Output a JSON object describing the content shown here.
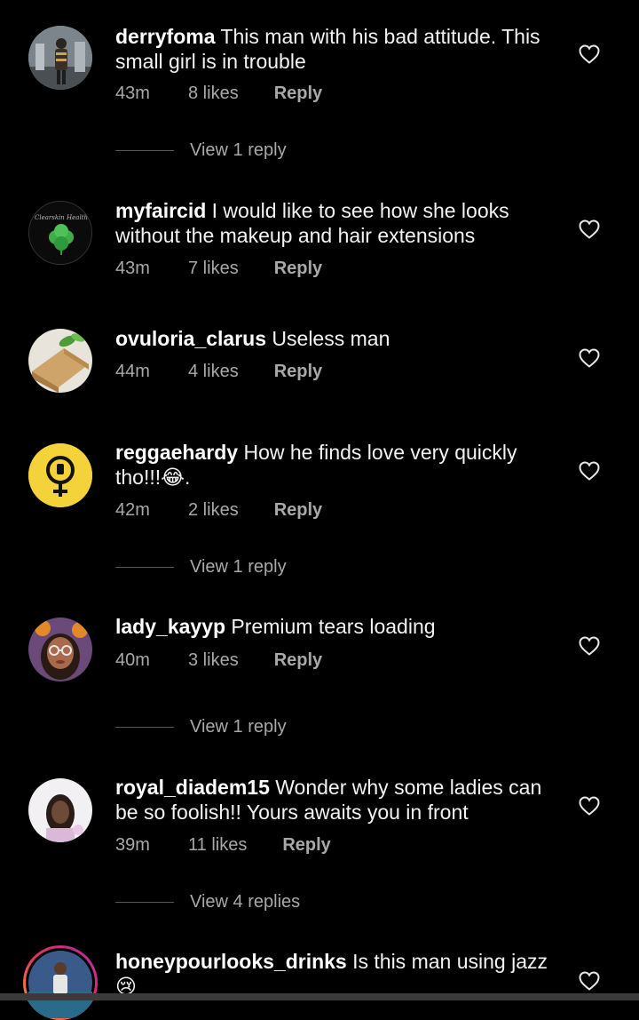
{
  "comments": [
    {
      "username": "derryfoma",
      "text": "This man with his bad attitude. This small girl is in trouble",
      "time": "43m",
      "likes": "8 likes",
      "reply": "Reply",
      "view_replies": "View 1 reply"
    },
    {
      "username": "myfaircid",
      "text": "I would like to see how she looks without the makeup and hair extensions",
      "time": "43m",
      "likes": "7 likes",
      "reply": "Reply",
      "view_replies": ""
    },
    {
      "username": "ovuloria_clarus",
      "text": "Useless man",
      "time": "44m",
      "likes": "4 likes",
      "reply": "Reply",
      "view_replies": ""
    },
    {
      "username": "reggaehardy",
      "text": "How he finds love very quickly tho!!!😂.",
      "time": "42m",
      "likes": "2 likes",
      "reply": "Reply",
      "view_replies": "View 1 reply"
    },
    {
      "username": "lady_kayyp",
      "text": "Premium tears loading",
      "time": "40m",
      "likes": "3 likes",
      "reply": "Reply",
      "view_replies": "View 1 reply"
    },
    {
      "username": "royal_diadem15",
      "text": "Wonder why some ladies can be so foolish!! Yours awaits you in front",
      "time": "39m",
      "likes": "11 likes",
      "reply": "Reply",
      "view_replies": "View 4 replies"
    },
    {
      "username": "honeypourlooks_drinks",
      "text": "Is this man using jazz 😢",
      "time": "",
      "likes": "",
      "reply": "",
      "view_replies": ""
    }
  ],
  "icons": {
    "like": "heart-outline-icon"
  }
}
